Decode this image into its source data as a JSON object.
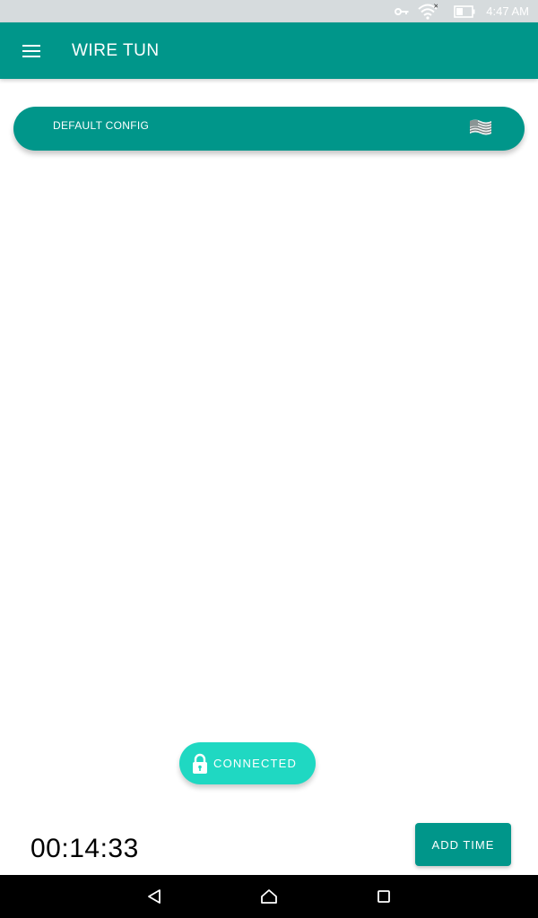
{
  "status_bar": {
    "time": "4:47 AM",
    "icons": [
      "vpn-key-icon",
      "wifi-icon",
      "battery-icon"
    ]
  },
  "app_bar": {
    "title": "WIRE TUN",
    "menu_icon": "hamburger-menu-icon"
  },
  "config": {
    "label": "DEFAULT CONFIG",
    "flag_icon": "us-flag-icon"
  },
  "connection": {
    "status_label": "CONNECTED",
    "icon": "lock-icon"
  },
  "timer": {
    "value": "00:14:33"
  },
  "actions": {
    "add_time_label": "ADD TIME"
  },
  "colors": {
    "primary": "#00968a",
    "accent": "#1fd8c2",
    "status_bar": "#d6dbdd"
  },
  "nav_bar": {
    "buttons": [
      "back-icon",
      "home-icon",
      "recents-icon"
    ]
  }
}
